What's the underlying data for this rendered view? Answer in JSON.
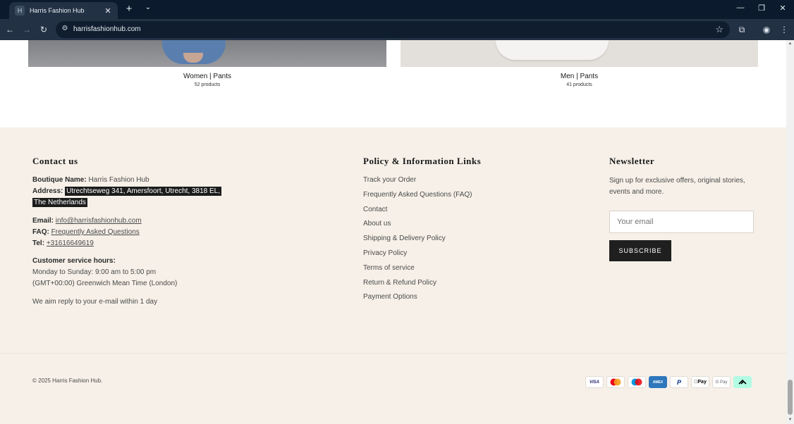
{
  "browser": {
    "tab_title": "Harris Fashion Hub",
    "tab_favicon": "H",
    "url": "harrisfashionhub.com"
  },
  "collections": [
    {
      "name": "Women | Pants",
      "count": "52 products"
    },
    {
      "name": "Men | Pants",
      "count": "41 products"
    }
  ],
  "contact": {
    "heading": "Contact us",
    "boutique_label": "Boutique Name:",
    "boutique_value": "Harris Fashion Hub",
    "address_label": "Address:",
    "address_line1": "Utrechtseweg 341, Amersfoort, Utrecht, 3818 EL,",
    "address_line2": "The Netherlands",
    "email_label": "Email:",
    "email_value": "info@harrisfashionhub.com",
    "faq_label": "FAQ:",
    "faq_value": "Frequently Asked Questions",
    "tel_label": "Tel:",
    "tel_value": "+31616649619",
    "hours_label": "Customer service hours:",
    "hours_line1": "Monday to Sunday: 9:00 am to 5:00 pm",
    "hours_line2": "(GMT+00:00) Greenwich Mean Time (London)",
    "reply_note": "We aim reply to your e-mail within 1 day"
  },
  "policy": {
    "heading": "Policy & Information Links",
    "links": [
      "Track your Order",
      "Frequently Asked Questions (FAQ)",
      "Contact",
      "About us",
      "Shipping & Delivery Policy",
      "Privacy Policy",
      "Terms of service",
      "Return & Refund Policy",
      "Payment Options"
    ]
  },
  "newsletter": {
    "heading": "Newsletter",
    "description": "Sign up for exclusive offers, original stories, events and more.",
    "email_placeholder": "Your email",
    "subscribe_label": "SUBSCRIBE"
  },
  "copyright": "© 2025 Harris Fashion Hub.",
  "payments": [
    {
      "icon": "visa-icon",
      "label": "VISA",
      "color": "#1a1f71"
    },
    {
      "icon": "mastercard-icon",
      "label": "",
      "color": "#eb001b"
    },
    {
      "icon": "maestro-icon",
      "label": "",
      "color": "#0099df"
    },
    {
      "icon": "amex-icon",
      "label": "AMEX",
      "color": "#2e77bc"
    },
    {
      "icon": "paypal-icon",
      "label": "P",
      "color": "#003087"
    },
    {
      "icon": "apple-pay-icon",
      "label": "Pay",
      "color": "#000000"
    },
    {
      "icon": "google-pay-icon",
      "label": "G Pay",
      "color": "#5f6368"
    },
    {
      "icon": "afterpay-icon",
      "label": "",
      "color": "#b2fce4"
    }
  ]
}
